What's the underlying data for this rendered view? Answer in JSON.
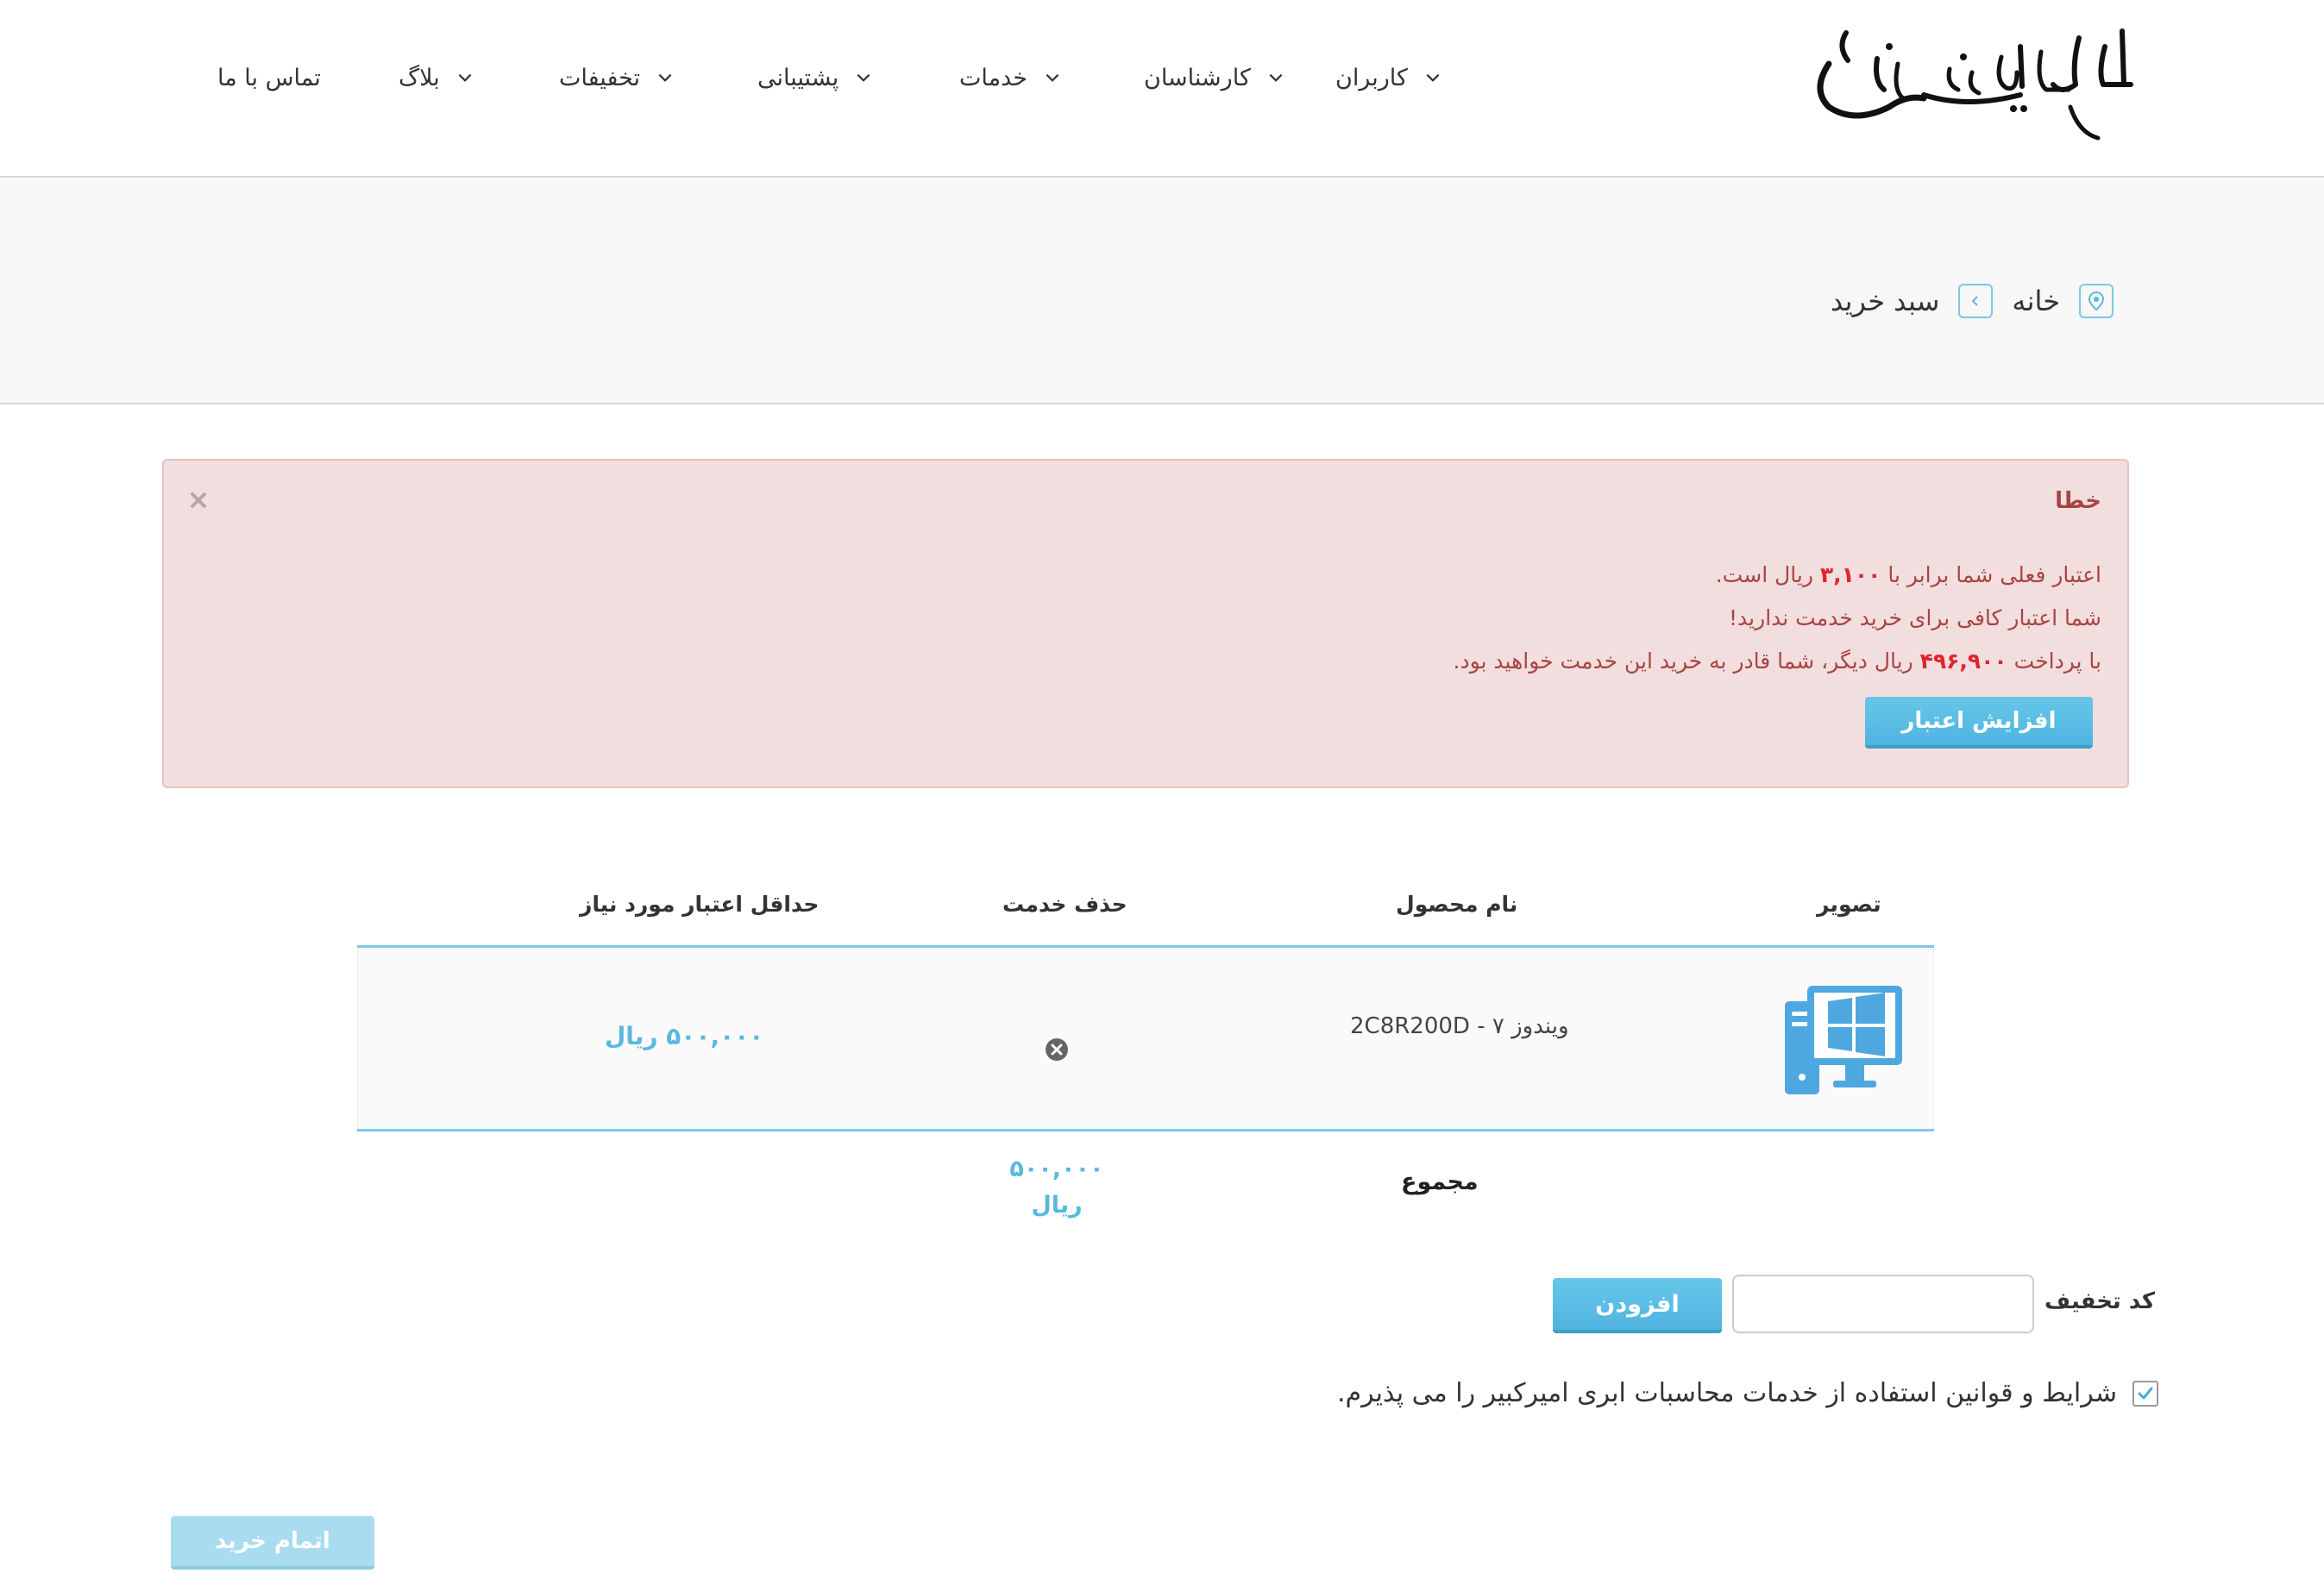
{
  "logo": {
    "text": "ابررایانه ملی سیمرغ"
  },
  "nav": [
    {
      "label": "کاربران"
    },
    {
      "label": "کارشناسان"
    },
    {
      "label": "خدمات"
    },
    {
      "label": "پشتیبانی"
    },
    {
      "label": "تخفیفات"
    },
    {
      "label": "بلاگ"
    },
    {
      "label": "تماس با ما"
    }
  ],
  "breadcrumb": {
    "home": "خانه",
    "current": "سبد خرید"
  },
  "alert": {
    "title": "خطا",
    "line1_pre": "اعتبار فعلی شما برابر با",
    "current_credit": "۳,۱۰۰",
    "line1_post": "ریال است.",
    "line2": "شما اعتبار کافی برای خرید خدمت ندارید!",
    "line3_pre": "با پرداخت",
    "needed_amount": "۴۹۶,۹۰۰",
    "line3_post": "ریال دیگر، شما قادر به خرید این خدمت خواهید بود.",
    "button": "افزایش اعتبار"
  },
  "table": {
    "headers": {
      "image": "تصویر",
      "product": "نام محصول",
      "remove": "حذف خدمت",
      "min_credit": "حداقل اعتبار مورد نیاز"
    },
    "rows": [
      {
        "product": "ویندوز ۷ - 2C8R200D",
        "icon": "windows-pc-icon",
        "min_credit": "۵۰۰,۰۰۰ ریال"
      }
    ],
    "total_label": "مجموع",
    "total_value": "۵۰۰,۰۰۰",
    "total_unit": "ریال"
  },
  "discount": {
    "label": "کد تخفیف",
    "value": "",
    "button": "افزودن"
  },
  "terms": {
    "text": "شرایط و قوانین استفاده از خدمات محاسبات ابری امیرکبیر را می پذیرم.",
    "checked": true
  },
  "finish_button": "اتمام خرید",
  "colors": {
    "accent": "#5ab8dd",
    "error_bg": "#f2dede",
    "error_text": "#a94442",
    "error_highlight": "#e0242c"
  }
}
